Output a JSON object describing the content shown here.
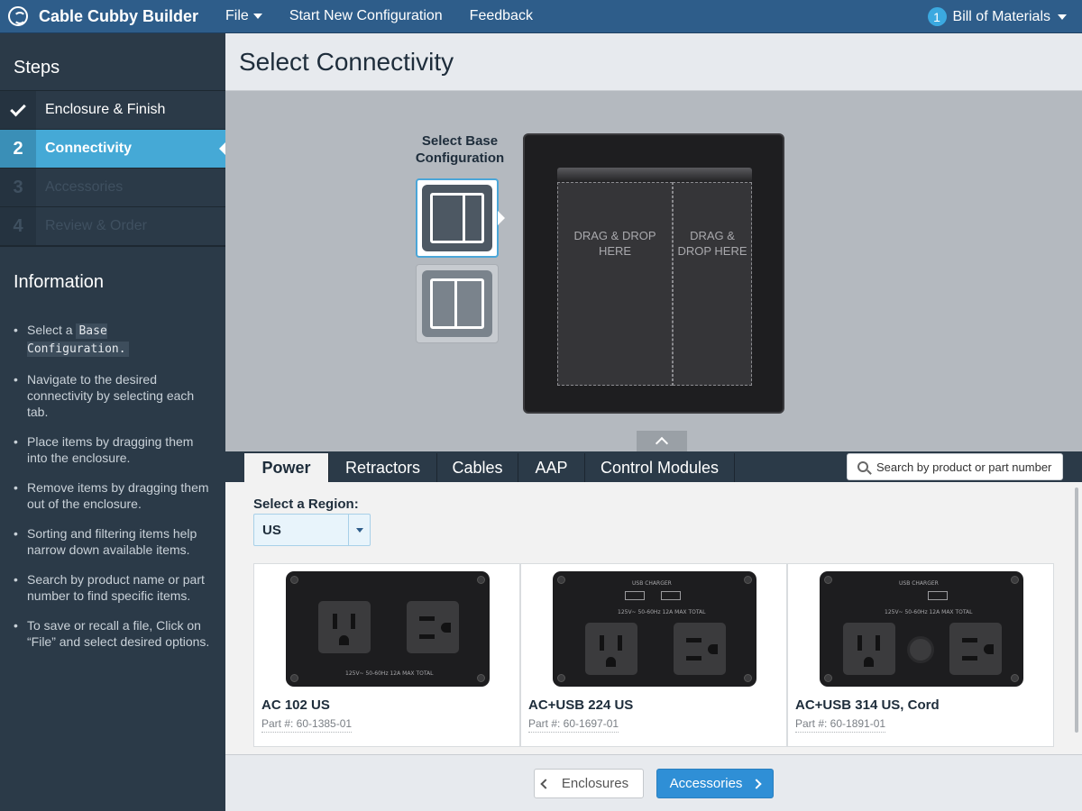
{
  "app": {
    "title": "Cable Cubby Builder",
    "menu": [
      "File",
      "Start New Configuration",
      "Feedback"
    ],
    "bom_count": "1",
    "bom_label": "Bill of Materials"
  },
  "sidebar": {
    "steps_title": "Steps",
    "steps": [
      {
        "num": "",
        "label": "Enclosure & Finish",
        "state": "done"
      },
      {
        "num": "2",
        "label": "Connectivity",
        "state": "active"
      },
      {
        "num": "3",
        "label": "Accessories",
        "state": "disabled"
      },
      {
        "num": "4",
        "label": "Review & Order",
        "state": "disabled"
      }
    ],
    "info_title": "Information",
    "info": {
      "item1_prefix": "Select a",
      "item1_code": "Base Configuration.",
      "item2": "Navigate to the desired connectivity by selecting each tab.",
      "item3": "Place items by dragging them into the enclosure.",
      "item4": "Remove items by dragging them out of the enclosure.",
      "item5": "Sorting and filtering items help narrow down available items.",
      "item6": "Search by product name or part number to find specific items.",
      "item7": "To save or recall a file, Click on “File” and select desired options."
    }
  },
  "main": {
    "page_title": "Select Connectivity",
    "base_config_label": "Select Base Configuration",
    "drop_left": "DRAG & DROP HERE",
    "drop_right": "DRAG & DROP HERE",
    "tabs": [
      "Power",
      "Retractors",
      "Cables",
      "AAP",
      "Control Modules"
    ],
    "search_placeholder": "Search by product or part number",
    "region_label": "Select a Region:",
    "region_value": "US",
    "products": [
      {
        "name": "AC 102 US",
        "part": "Part #: 60-1385-01",
        "plate_text": "125V~ 50-60Hz 12A MAX TOTAL"
      },
      {
        "name": "AC+USB 224 US",
        "part": "Part #: 60-1697-01",
        "plate_text": "125V~ 50-60Hz 12A MAX TOTAL",
        "usb_label": "USB CHARGER"
      },
      {
        "name": "AC+USB 314 US, Cord",
        "part": "Part #: 60-1891-01",
        "plate_text": "125V~ 50-60Hz 12A MAX TOTAL",
        "usb_label": "USB CHARGER"
      }
    ],
    "footer": {
      "back": "Enclosures",
      "next": "Accessories"
    }
  },
  "colors": {
    "topbar": "#2e5d8a",
    "accent": "#45a9d6",
    "sidebar": "#2b3a48",
    "primary_button": "#2f8fd6"
  }
}
